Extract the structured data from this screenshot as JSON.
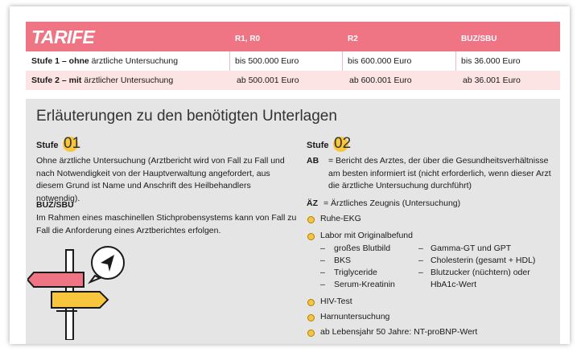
{
  "tarife": {
    "title": "TARIFE",
    "columns": [
      "R1, R0",
      "R2",
      "BUZ/SBU"
    ],
    "rows": [
      {
        "label_bold": "Stufe 1 – ohne",
        "label_rest": " ärztliche Untersuchung",
        "values": [
          "bis 500.000 Euro",
          "bis 600.000 Euro",
          "bis 36.000 Euro"
        ]
      },
      {
        "label_bold": "Stufe 2 – mit",
        "label_rest": " ärztlicher Untersuchung",
        "values": [
          "ab 500.001 Euro",
          "ab 600.001 Euro",
          "ab 36.001 Euro"
        ]
      }
    ]
  },
  "explain": {
    "heading": "Erläuterungen zu den benötigten Unterlagen",
    "stufe_word": "Stufe",
    "stufe1_num": "01",
    "stufe2_num": "02",
    "stufe1_text": "Ohne ärztliche Untersuchung (Arztbericht wird von Fall zu Fall und nach Notwendigkeit von der Hauptverwaltung angefordert, aus diesem Grund ist Name und Anschrift des Heilbehandlers notwendig).",
    "buz_heading": "BUZ/SBU",
    "buz_text": "Im Rahmen eines maschinellen Stichprobensystems kann von Fall zu Fall die Anforderung eines Arztberichtes erfolgen.",
    "ab_label": "AB",
    "ab_text": "= Bericht des Arztes, der über die Gesundheitsverhältnisse am besten informiert ist (nicht erforderlich, wenn dieser Arzt die ärztliche Untersuchung durchführt)",
    "az_label": "ÄZ",
    "az_text": "= Ärztliches Zeugnis (Untersuchung)",
    "items": {
      "ekg": "Ruhe-EKG",
      "labor": "Labor mit Originalbefund",
      "hiv": "HIV-Test",
      "harn": "Harnuntersuchung",
      "nt": "ab Lebensjahr 50 Jahre: NT-proBNP-Wert"
    },
    "labor_left": [
      "großes Blutbild",
      "BKS",
      "Triglyceride",
      "Serum-Kreatinin"
    ],
    "labor_right": [
      "Gamma-GT und GPT",
      "Cholesterin (gesamt + HDL)",
      "Blutzucker (nüchtern) oder",
      "HbA1c-Wert"
    ]
  },
  "colors": {
    "accent": "#ef7585",
    "row_tint": "#fde4e4",
    "panel": "#e5e5e5",
    "dot": "#f8c63d"
  }
}
